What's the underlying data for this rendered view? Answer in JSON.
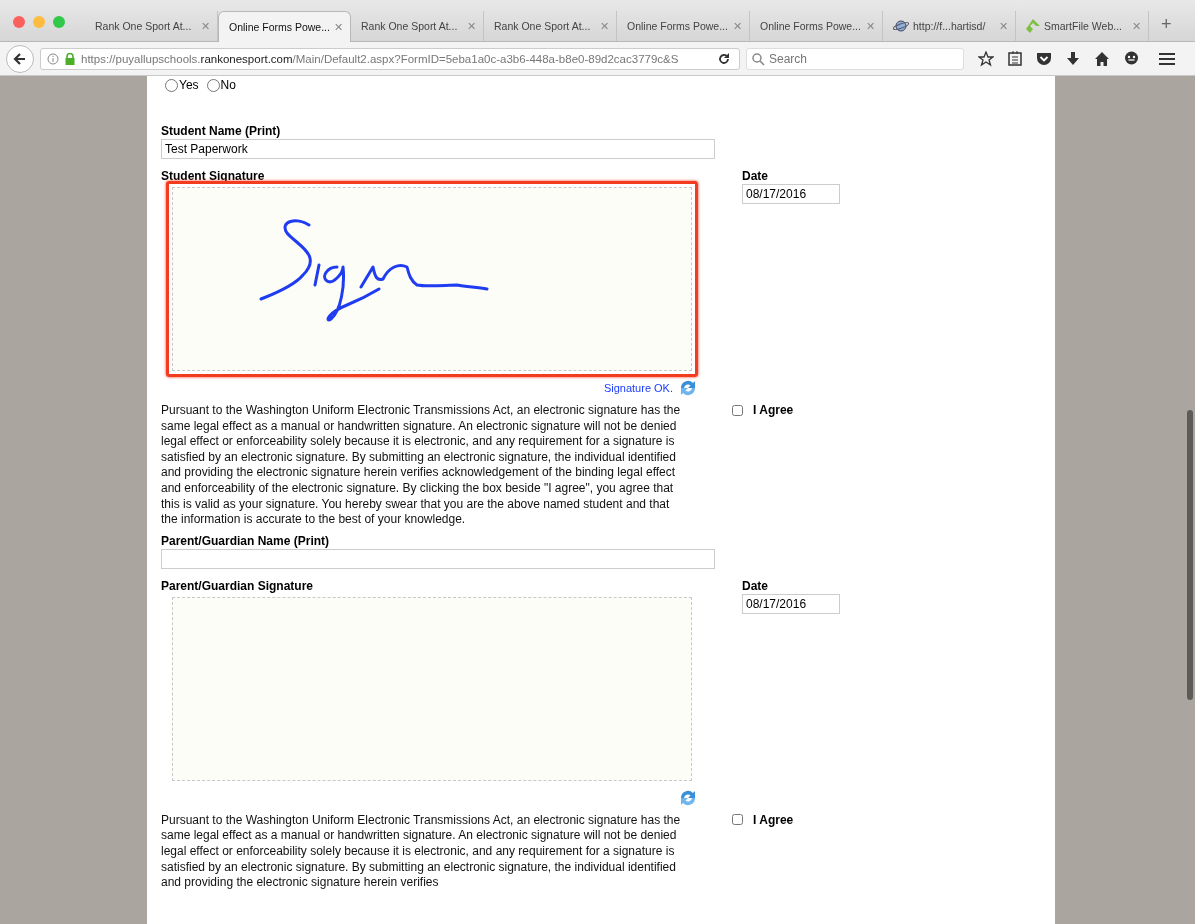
{
  "browser": {
    "tabs": [
      {
        "title": "Rank One Sport At...",
        "close": "✕",
        "selected": false,
        "kind": "page"
      },
      {
        "title": "Online Forms Powe...",
        "close": "✕",
        "selected": true,
        "kind": "page"
      },
      {
        "title": "Rank One Sport At...",
        "close": "✕",
        "selected": false,
        "kind": "page"
      },
      {
        "title": "Rank One Sport At...",
        "close": "✕",
        "selected": false,
        "kind": "page"
      },
      {
        "title": "Online Forms Powe...",
        "close": "✕",
        "selected": false,
        "kind": "page"
      },
      {
        "title": "Online Forms Powe...",
        "close": "✕",
        "selected": false,
        "kind": "page"
      },
      {
        "title": "http://f...hartisd/",
        "close": "✕",
        "selected": false,
        "kind": "globe"
      },
      {
        "title": "SmartFile Web...",
        "close": "✕",
        "selected": false,
        "kind": "leaf"
      }
    ],
    "new_tab": "+",
    "address": {
      "prefix": "https://puyallupschools.",
      "domain": "rankonesport.com",
      "path": "/Main/Default2.aspx?FormID=5eba1a0c-a3b6-448a-b8e0-89d2cac3779c&S"
    },
    "search": {
      "placeholder": "Search"
    }
  },
  "form": {
    "radio_options": [
      {
        "label": "Yes",
        "selected": false
      },
      {
        "label": "No",
        "selected": false
      }
    ],
    "sections": [
      {
        "name_label": "Student Name (Print)",
        "name_value": "Test Paperwork",
        "signature_label_full": "Student Signature",
        "date_label": "Date",
        "date_value": "08/17/2016",
        "signed": true,
        "highlighted": true,
        "status": "Signature OK.",
        "disclaimer": "Pursuant to the Washington Uniform Electronic Transmissions Act, an electronic signature has the same legal effect as a manual or handwritten signature. An electronic signature will not be denied legal effect or enforceability solely because it is electronic, and any requirement for a signature is satisfied by an electronic signature. By submitting an electronic signature, the individual identified and providing the electronic signature herein verifies acknowledgement of the binding legal effect and enforceability of the electronic signature. By clicking the box beside \"I agree\", you agree that this is valid as your signature. You hereby swear that you are the above named student and that the information is accurate to the best of your knowledge.",
        "agree": {
          "label": "I Agree",
          "checked": false
        }
      },
      {
        "name_label": "Parent/Guardian Name (Print)",
        "signature_label_full": "Parent/Guardian Signature",
        "date_label": "Date",
        "date_value": "08/17/2016",
        "signed": false,
        "highlighted": false,
        "disclaimer": "Pursuant to the Washington Uniform Electronic Transmissions Act, an electronic signature has the same legal effect as a manual or handwritten signature. An electronic signature will not be denied legal effect or enforceability solely because it is electronic, and any requirement for a signature is satisfied by an electronic signature. By submitting an electronic signature, the individual identified and providing the electronic signature herein verifies",
        "agree": {
          "label": "I Agree",
          "checked": false
        }
      }
    ]
  }
}
